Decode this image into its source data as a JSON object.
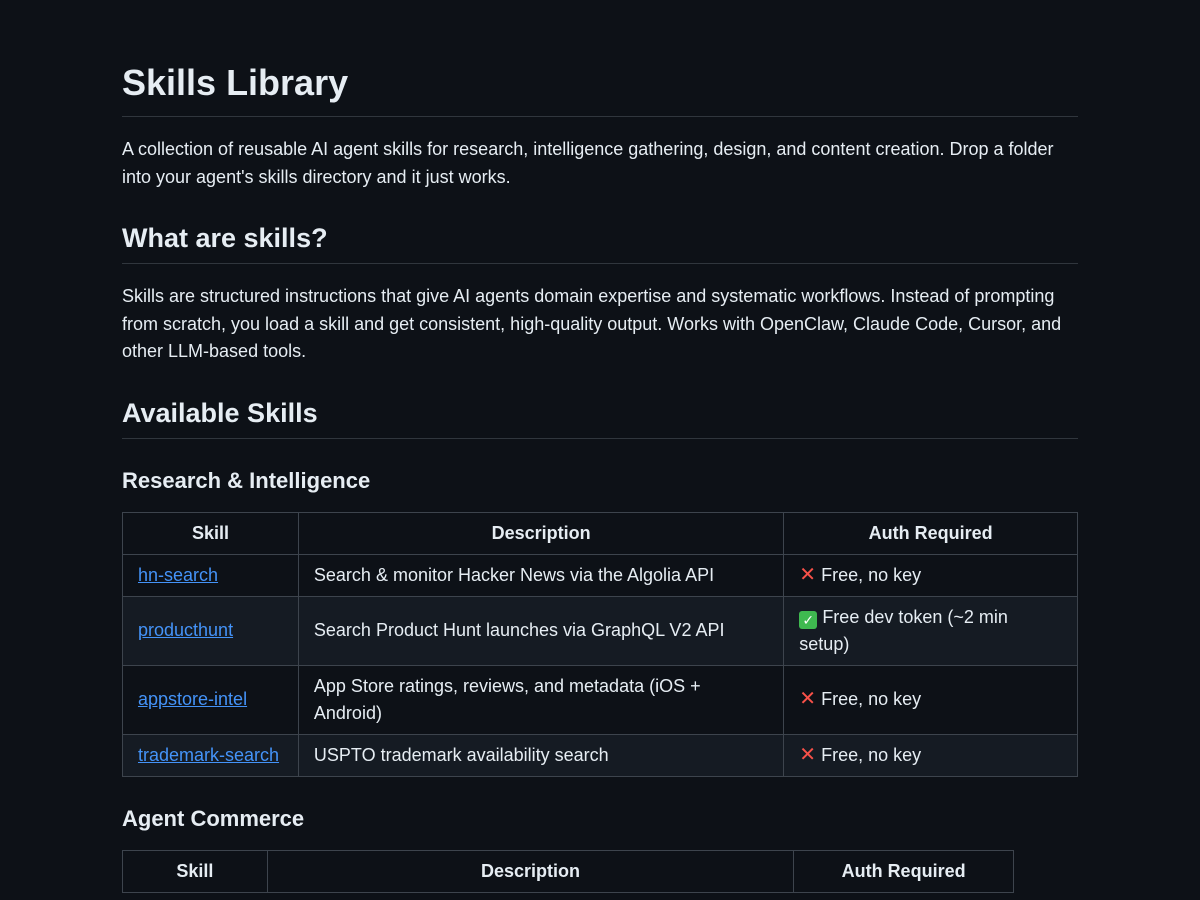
{
  "title": "Skills Library",
  "intro": "A collection of reusable AI agent skills for research, intelligence gathering, design, and content creation. Drop a folder into your agent's skills directory and it just works.",
  "what_heading": "What are skills?",
  "what_body": "Skills are structured instructions that give AI agents domain expertise and systematic workflows. Instead of prompting from scratch, you load a skill and get consistent, high-quality output. Works with OpenClaw, Claude Code, Cursor, and other LLM-based tools.",
  "available_heading": "Available Skills",
  "research": {
    "heading": "Research & Intelligence",
    "headers": [
      "Skill",
      "Description",
      "Auth Required"
    ],
    "rows": [
      {
        "skill": "hn-search",
        "description": "Search & monitor Hacker News via the Algolia API",
        "auth_icon": "cross-mark-icon",
        "auth": "Free, no key"
      },
      {
        "skill": "producthunt",
        "description": "Search Product Hunt launches via GraphQL V2 API",
        "auth_icon": "check-mark-icon",
        "auth": "Free dev token (~2 min setup)"
      },
      {
        "skill": "appstore-intel",
        "description": "App Store ratings, reviews, and metadata (iOS + Android)",
        "auth_icon": "cross-mark-icon",
        "auth": "Free, no key"
      },
      {
        "skill": "trademark-search",
        "description": "USPTO trademark availability search",
        "auth_icon": "cross-mark-icon",
        "auth": "Free, no key"
      }
    ]
  },
  "commerce": {
    "heading": "Agent Commerce",
    "headers": [
      "Skill",
      "Description",
      "Auth Required"
    ]
  },
  "colors": {
    "background": "#0d1117",
    "text": "#e6edf3",
    "link": "#4493f8",
    "border": "#3d444d",
    "cross": "#f85149",
    "check": "#3fb950"
  }
}
